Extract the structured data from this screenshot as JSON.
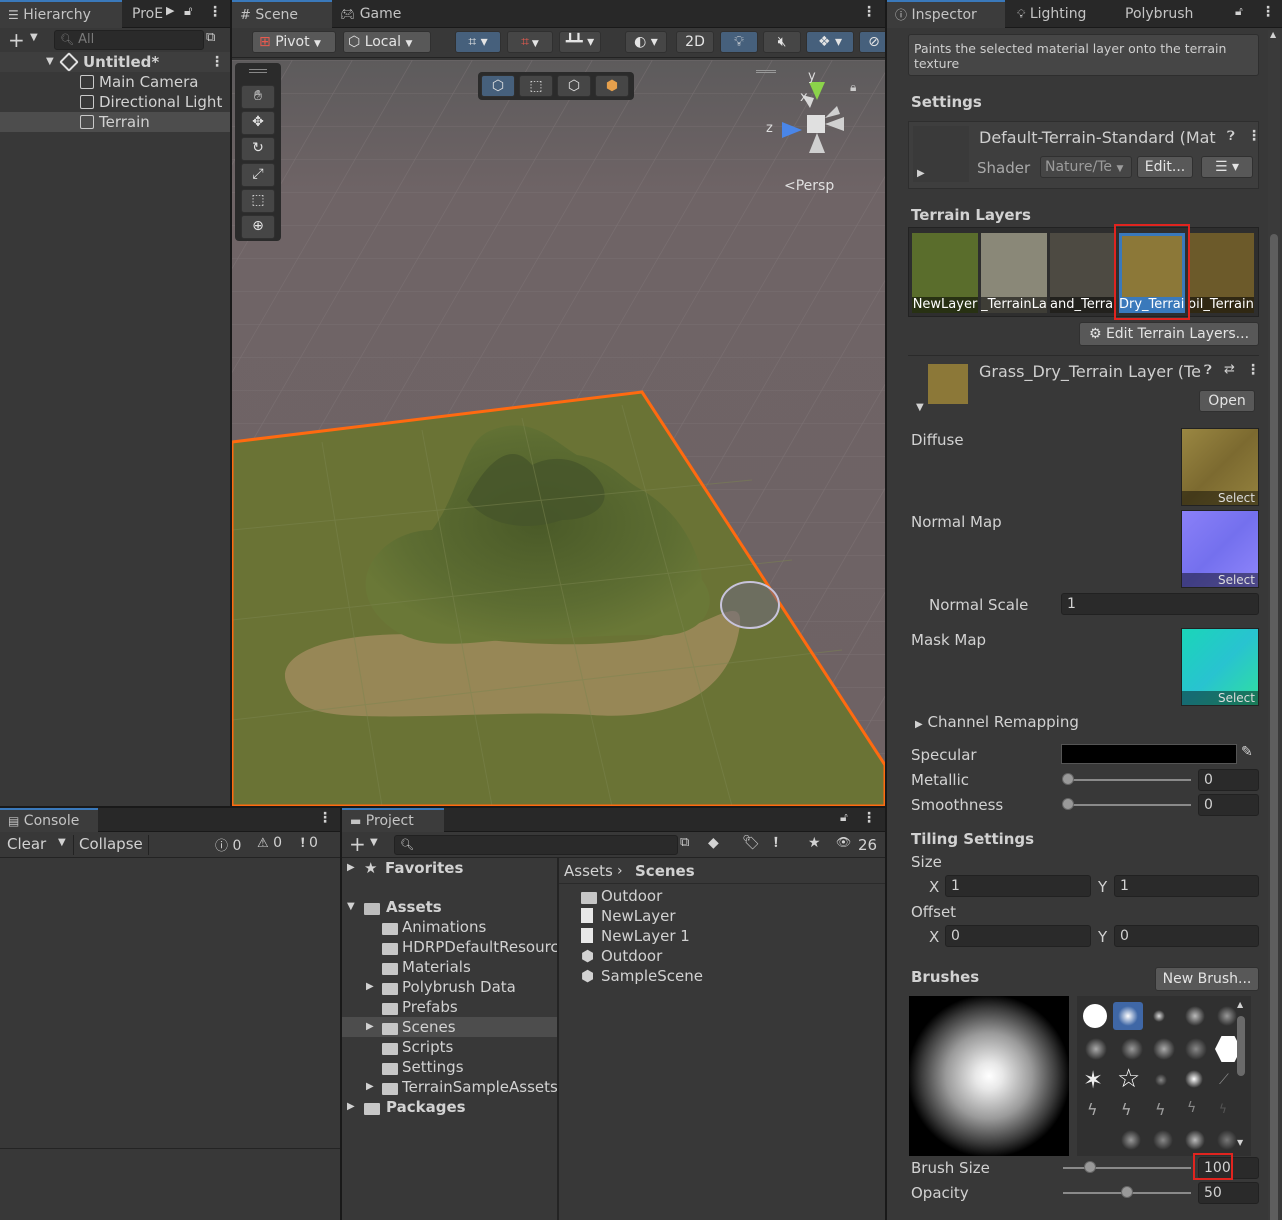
{
  "hierarchy": {
    "tab_label": "Hierarchy",
    "tab2_label": "ProE",
    "search_placeholder": "All",
    "scene_name": "Untitled*",
    "items": [
      {
        "label": "Main Camera"
      },
      {
        "label": "Directional Light"
      },
      {
        "label": "Terrain"
      }
    ]
  },
  "scene_view": {
    "tab_scene": "Scene",
    "tab_game": "Game",
    "pivot_label": "Pivot",
    "local_label": "Local",
    "mode_2d": "2D",
    "persp_label": "<Persp",
    "axis_y": "y",
    "axis_x": "x",
    "axis_z": "z"
  },
  "console": {
    "tab_label": "Console",
    "clear_label": "Clear",
    "collapse_label": "Collapse",
    "info_count": "0",
    "warn_count": "0",
    "error_count": "0"
  },
  "project": {
    "tab_label": "Project",
    "hidden_count": "26",
    "favorites_label": "Favorites",
    "assets_label": "Assets",
    "asset_folders": [
      {
        "label": "Animations",
        "expandable": false
      },
      {
        "label": "HDRPDefaultResources",
        "expandable": false
      },
      {
        "label": "Materials",
        "expandable": false
      },
      {
        "label": "Polybrush Data",
        "expandable": true
      },
      {
        "label": "Prefabs",
        "expandable": false
      },
      {
        "label": "Scenes",
        "expandable": true
      },
      {
        "label": "Scripts",
        "expandable": false
      },
      {
        "label": "Settings",
        "expandable": false
      },
      {
        "label": "TerrainSampleAssets",
        "expandable": true
      }
    ],
    "packages_label": "Packages",
    "breadcrumb_root": "Assets",
    "breadcrumb_current": "Scenes",
    "scene_items": [
      {
        "label": "Outdoor",
        "kind": "folder"
      },
      {
        "label": "NewLayer",
        "kind": "file"
      },
      {
        "label": "NewLayer 1",
        "kind": "file"
      },
      {
        "label": "Outdoor",
        "kind": "scene"
      },
      {
        "label": "SampleScene",
        "kind": "scene"
      }
    ]
  },
  "inspector": {
    "tab_inspector": "Inspector",
    "tab_lighting": "Lighting",
    "tab_polybrush": "Polybrush",
    "help_text": "Paints the selected material layer onto the terrain texture",
    "settings_header": "Settings",
    "material_name": "Default-Terrain-Standard (Mat",
    "shader_label": "Shader",
    "shader_value": "Nature/Te",
    "edit_label": "Edit...",
    "terrain_layers_header": "Terrain Layers",
    "terrain_layers": [
      {
        "label": "NewLayer",
        "color": "#5a6d2c"
      },
      {
        "label": "_TerrainLa",
        "color": "#8a8878"
      },
      {
        "label": "and_Terrai",
        "color": "#4d4a42"
      },
      {
        "label": "Dry_Terrain",
        "color": "#8c7838"
      },
      {
        "label": "oil_Terrain",
        "color": "#6c5a2a"
      }
    ],
    "edit_terrain_layers_label": "Edit Terrain Layers...",
    "layer_name": "Grass_Dry_Terrain Layer (Te",
    "open_label": "Open",
    "diffuse_label": "Diffuse",
    "normal_map_label": "Normal Map",
    "normal_scale_label": "Normal Scale",
    "normal_scale_value": "1",
    "mask_map_label": "Mask Map",
    "select_label": "Select",
    "channel_remapping_label": "Channel Remapping",
    "specular_label": "Specular",
    "specular_color": "#000000",
    "metallic_label": "Metallic",
    "metallic_value": "0",
    "smoothness_label": "Smoothness",
    "smoothness_value": "0",
    "tiling_header": "Tiling Settings",
    "size_label": "Size",
    "offset_label": "Offset",
    "x_label": "X",
    "y_label": "Y",
    "size_x": "1",
    "size_y": "1",
    "offset_x": "0",
    "offset_y": "0",
    "brushes_header": "Brushes",
    "new_brush_label": "New Brush...",
    "brush_size_label": "Brush Size",
    "brush_size_value": "100",
    "opacity_label": "Opacity",
    "opacity_value": "50"
  },
  "colors": {
    "accent_blue": "#3a79bb",
    "highlight_red": "#e0241f",
    "terrain_outline": "#ff6a10"
  }
}
